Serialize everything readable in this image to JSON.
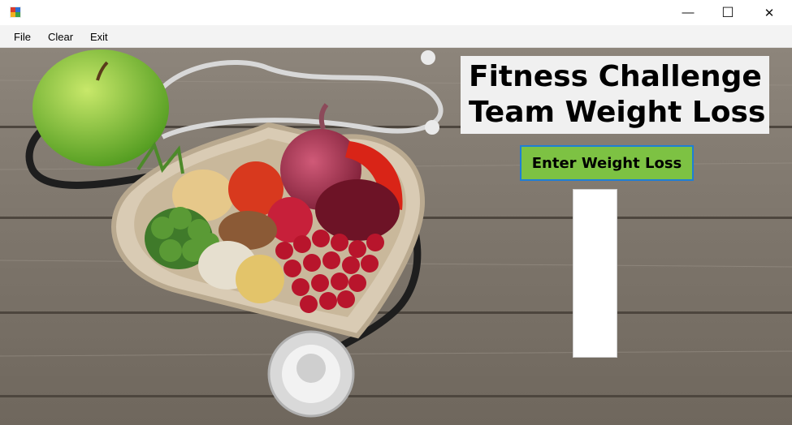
{
  "window": {
    "minimize_glyph": "—",
    "maximize_glyph": "☐",
    "close_glyph": "✕"
  },
  "menu": {
    "items": [
      {
        "label": "File"
      },
      {
        "label": "Clear"
      },
      {
        "label": "Exit"
      }
    ]
  },
  "main": {
    "title_line1": "Fitness Challenge",
    "title_line2": "Team Weight Loss",
    "enter_button_label": "Enter Weight Loss",
    "result_text": ""
  },
  "colors": {
    "button_green": "#7dc243",
    "button_border": "#1e7fd6",
    "title_panel_bg": "#f0f0f0"
  },
  "icons": [
    "app-icon",
    "minimize-icon",
    "maximize-icon",
    "close-icon"
  ]
}
